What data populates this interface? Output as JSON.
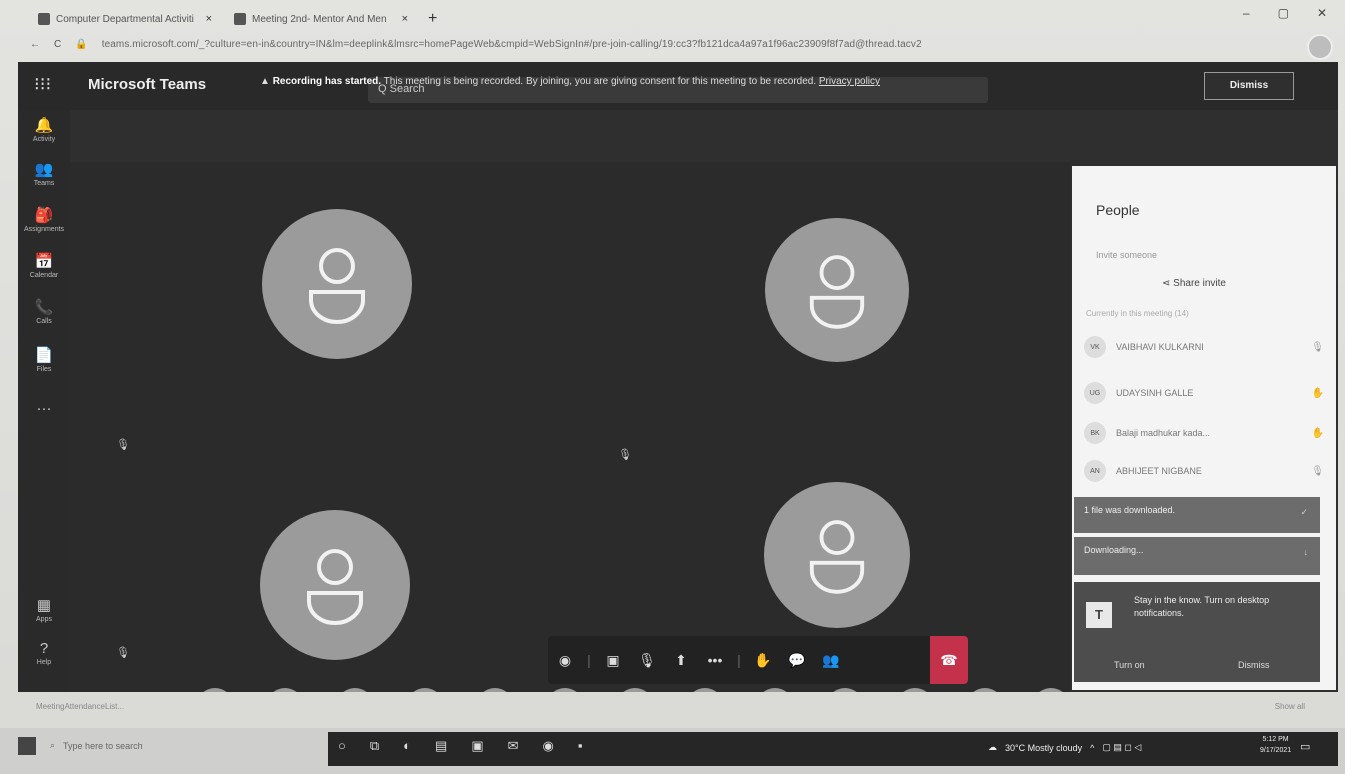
{
  "browser": {
    "tabs": [
      {
        "label": "Computer Departmental Activiti",
        "close": "×"
      },
      {
        "label": "Meeting 2nd- Mentor And Men",
        "close": "×"
      }
    ],
    "new_tab": "+",
    "url": "teams.microsoft.com/_?culture=en-in&country=IN&lm=deeplink&lmsrc=homePageWeb&cmpid=WebSignIn#/pre-join-calling/19:cc3?fb121dca4a97a1f96ac23909f8f7ad@thread.tacv2",
    "window_controls": [
      "–",
      "▢",
      "✕"
    ],
    "extensions": [
      "⊶",
      "☆",
      "✱",
      "●",
      "⋮"
    ]
  },
  "teams": {
    "brand": "Microsoft Teams",
    "waffle": "⁝⁝⁝",
    "search_placeholder": "Q  Search",
    "more": "···",
    "rail": [
      {
        "icon": "🔔",
        "label": "Activity"
      },
      {
        "icon": "👥",
        "label": "Teams"
      },
      {
        "icon": "🎒",
        "label": "Assignments"
      },
      {
        "icon": "📅",
        "label": "Calendar"
      },
      {
        "icon": "📞",
        "label": "Calls"
      },
      {
        "icon": "📄",
        "label": "Files"
      },
      {
        "icon": "···",
        "label": ""
      },
      {
        "icon": "▦",
        "label": "Apps"
      },
      {
        "icon": "?",
        "label": "Help"
      }
    ],
    "banner": {
      "icon": "▲",
      "bold": "Recording has started.",
      "text": " This meeting is being recorded. By joining, you are giving consent for this meeting to be recorded. ",
      "link": "Privacy policy"
    },
    "banner_dismiss": "Dismiss",
    "controls": {
      "info": "◉",
      "camera": "▣",
      "mic": "🎙",
      "share": "⬆",
      "more": "•••",
      "raise_hand": "✋",
      "chat": "💬",
      "people": "👥",
      "hangup": "☎"
    },
    "people_pane": {
      "title": "People",
      "invite_placeholder": "Invite someone",
      "share_invite": "Share invite",
      "in_call": "Currently in this meeting (14)",
      "participants": [
        {
          "initials": "VK",
          "name": "VAIBHAVI KULKARNI"
        },
        {
          "initials": "UG",
          "name": "UDAYSINH GALLE"
        },
        {
          "initials": "BK",
          "name": "Balaji madhukar kada..."
        },
        {
          "initials": "AN",
          "name": "ABHIJEET NIGBANE"
        }
      ]
    },
    "toasts": {
      "downloaded": "1 file was downloaded.",
      "downloading": "Downloading...",
      "notify_icon": "T",
      "notify_text": "Stay in the know. Turn on desktop notifications.",
      "turn_on": "Turn on",
      "dismiss": "Dismiss"
    }
  },
  "download_bar": {
    "file": "MeetingAttendanceList...",
    "show_all": "Show all"
  },
  "taskbar": {
    "search": "Type here to search",
    "weather": "30°C  Mostly cloudy",
    "time": "5:12 PM",
    "date": "9/17/2021"
  }
}
